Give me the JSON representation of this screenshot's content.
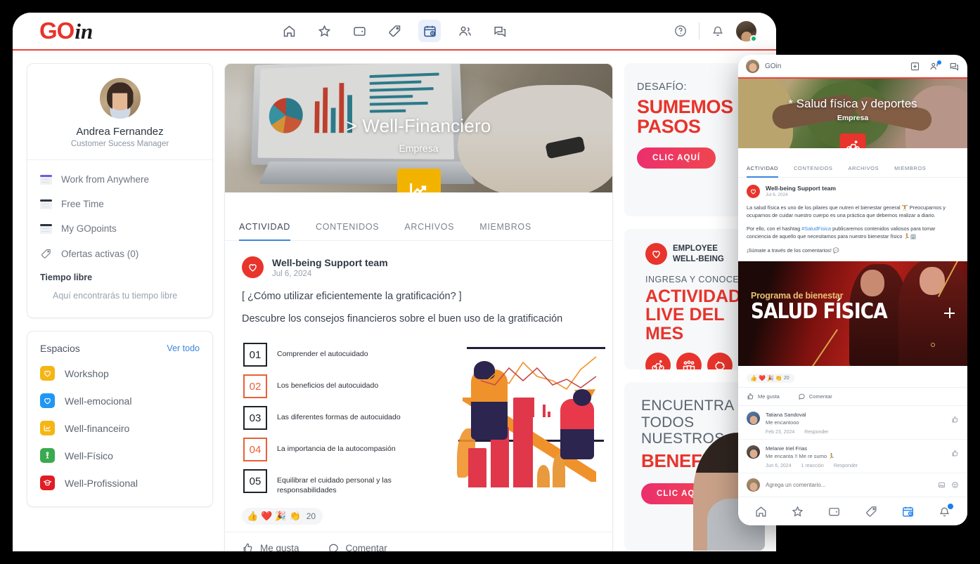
{
  "brand": {
    "go": "GO",
    "in": "in"
  },
  "topnav": [
    {
      "name": "home-icon",
      "label": "Inicio",
      "active": false
    },
    {
      "name": "star-icon",
      "label": "Favoritos",
      "active": false
    },
    {
      "name": "wallet-icon",
      "label": "Billetera",
      "active": false
    },
    {
      "name": "tag-icon",
      "label": "Ofertas",
      "active": false
    },
    {
      "name": "calendar-clock-icon",
      "label": "Calendario",
      "active": true
    },
    {
      "name": "people-icon",
      "label": "Personas",
      "active": false
    },
    {
      "name": "chat-icon",
      "label": "Mensajes",
      "active": false
    }
  ],
  "profile": {
    "name": "Andrea Fernandez",
    "role": "Customer Sucess Manager"
  },
  "sidebar": {
    "items": [
      {
        "label": "Work from Anywhere",
        "icon": "document-icon",
        "accent": "purple"
      },
      {
        "label": "Free Time",
        "icon": "document-icon",
        "accent": "dark"
      },
      {
        "label": "My GOpoints",
        "icon": "document-icon",
        "accent": "dark"
      },
      {
        "label": "Ofertas activas (0)",
        "icon": "tag-icon",
        "accent": "none"
      }
    ],
    "section_title": "Tiempo libre",
    "section_text": "Aquí encontrarás tu tiempo libre"
  },
  "spaces": {
    "title": "Espacios",
    "see_all": "Ver todo",
    "items": [
      {
        "label": "Workshop",
        "icon": "heart-icon",
        "color": "#f5b515"
      },
      {
        "label": "Well-emocional",
        "icon": "heart-icon",
        "color": "#2196f3"
      },
      {
        "label": "Well-financeiro",
        "icon": "chart-icon",
        "color": "#f5b515"
      },
      {
        "label": "Well-Físico",
        "icon": "person-icon",
        "color": "#3aaa4f"
      },
      {
        "label": "Well-Profissional",
        "icon": "graduation-icon",
        "color": "#e01d24"
      }
    ]
  },
  "banner": {
    "title": "> Well-Financiero",
    "subtitle": "Empresa",
    "badge_icon": "chart-up-icon"
  },
  "tabs": [
    {
      "label": "ACTIVIDAD",
      "active": true
    },
    {
      "label": "CONTENIDOS",
      "active": false
    },
    {
      "label": "ARCHIVOS",
      "active": false
    },
    {
      "label": "MIEMBROS",
      "active": false
    }
  ],
  "post": {
    "author": "Well-being Support team",
    "date": "Jul 6, 2024",
    "line1": "[ ¿Cómo utilizar eficientemente la gratificación? ]",
    "line2": "Descubre los consejos financieros sobre el buen uso de la gratificación",
    "infographic": [
      {
        "num": "01",
        "text": "Comprender el autocuidado",
        "alt": false
      },
      {
        "num": "02",
        "text": "Los beneficios del autocuidado",
        "alt": true
      },
      {
        "num": "03",
        "text": "Las diferentes formas de autocuidado",
        "alt": false
      },
      {
        "num": "04",
        "text": "La importancia de la autocompasión",
        "alt": true
      },
      {
        "num": "05",
        "text": "Equilibrar el cuidado personal y las responsabilidades",
        "alt": false
      }
    ],
    "reactions": {
      "emojis": [
        "👍",
        "❤️",
        "🎉",
        "👏"
      ],
      "count": "20"
    },
    "actions": [
      {
        "label": "Me gusta",
        "icon": "thumbs-up-icon"
      },
      {
        "label": "Comentar",
        "icon": "comment-icon"
      }
    ]
  },
  "promos": [
    {
      "kicker": "DESAFÍO:",
      "title_line1": "SUMEMOS",
      "title_line2": "PASOS",
      "cta": "CLIC AQUÍ"
    },
    {
      "badge_line1": "EMPLOYEE",
      "badge_line2": "WELL-BEING",
      "kicker": "INGRESA Y CONOCE",
      "title_line1": "ACTIVIDADES",
      "title_line2": "LIVE DEL MES",
      "icons": [
        "bike-icon",
        "group-icon",
        "piggy-bank-icon"
      ]
    },
    {
      "line1": "ENCUENTRA",
      "line2": "TODOS NUESTROS",
      "title": "BENEFICIOS",
      "cta": "CLIC AQUÍ"
    }
  ],
  "mobile": {
    "brand": "GOin",
    "top_icons": [
      {
        "name": "add-box-icon",
        "badge": false
      },
      {
        "name": "people-icon",
        "badge": true
      },
      {
        "name": "chat-icon",
        "badge": false
      }
    ],
    "banner": {
      "title": "* Salud física y deportes",
      "subtitle": "Empresa",
      "badge_icon": "bike-icon"
    },
    "tabs": [
      {
        "label": "ACTIVIDAD",
        "active": true
      },
      {
        "label": "CONTENIDOS",
        "active": false
      },
      {
        "label": "ARCHIVOS",
        "active": false
      },
      {
        "label": "MIEMBROS",
        "active": false
      }
    ],
    "post": {
      "author": "Well-being Support team",
      "date": "Jul 6, 2024",
      "para1": "La salud física es uno de los pilares que nutren el bienestar general 🏋 Preocuparnos y ocuparnos de cuidar nuestro cuerpo es una práctica que debemos realizar a diario.",
      "para2_pre": "Por ello, con el hashtag ",
      "para2_hash": "#SaludFisica",
      "para2_post": " publicaremos contenidos valiosos para tomar conciencia de aquello que necesitamos para nuestro bienestar físico 🏃🏢",
      "para3": "¡Súmate a través de los comentarios! 💬",
      "image_kicker": "Programa de bienestar",
      "image_title": "SALUD FÍSICA",
      "reactions": {
        "emojis": [
          "👍",
          "❤️",
          "🎉",
          "👏"
        ],
        "count": "20"
      },
      "actions": [
        {
          "label": "Me gusta",
          "icon": "thumbs-up-icon"
        },
        {
          "label": "Comentar",
          "icon": "comment-icon"
        }
      ]
    },
    "comments": [
      {
        "name": "Tatiana Sandoval",
        "text": "Me encantooo",
        "date": "Feb 23, 2024",
        "reactions": "",
        "reply": "Responder"
      },
      {
        "name": "Melanie Iriel Frias",
        "text": "Me encanta !! Me re sumo 🏃",
        "date": "Jun 6, 2024",
        "reactions": "1 reacción",
        "reply": "Responder"
      }
    ],
    "comment_placeholder": "Agrega un comentario...",
    "comment_icons": [
      "image-icon",
      "emoji-icon"
    ],
    "bottom_nav": [
      {
        "name": "home-icon",
        "active": false,
        "badge": false
      },
      {
        "name": "star-icon",
        "active": false,
        "badge": false
      },
      {
        "name": "wallet-icon",
        "active": false,
        "badge": false
      },
      {
        "name": "tag-icon",
        "active": false,
        "badge": false
      },
      {
        "name": "calendar-clock-icon",
        "active": true,
        "badge": false
      },
      {
        "name": "bell-icon",
        "active": false,
        "badge": true
      }
    ]
  }
}
